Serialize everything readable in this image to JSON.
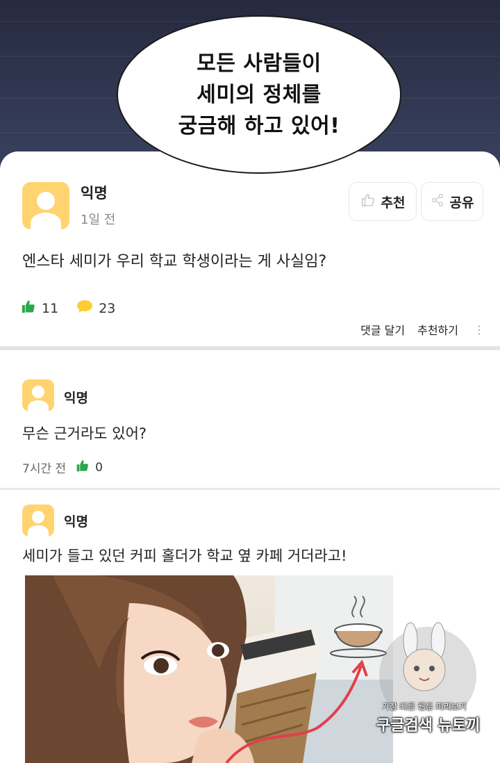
{
  "speech_bubble": {
    "lines": [
      "모든 사람들이",
      "세미의 정체를",
      "궁금해 하고 있어!"
    ]
  },
  "post": {
    "author": "익명",
    "time": "1일 전",
    "recommend_label": "추천",
    "share_label": "공유",
    "body": "엔스타 세미가 우리 학교 학생이라는 게 사실임?",
    "likes": "11",
    "comments": "23",
    "reply_label": "댓글 달기",
    "recommend_action_label": "추천하기",
    "more_label": "⋮"
  },
  "comments": [
    {
      "author": "익명",
      "body": "무슨 근거라도 있어?",
      "time": "7시간 전",
      "likes": "0"
    },
    {
      "author": "익명",
      "body": "세미가 들고 있던 커피 홀더가 학교 옆 카페 거더라고!"
    }
  ],
  "watermark": {
    "line1": "가장 빠른 웹툰 미리보기",
    "line2": "구글검색 뉴토끼"
  },
  "colors": {
    "avatar": "#ffd470",
    "like_green": "#2aa84a",
    "comment_yellow": "#ffcc33",
    "background_dark": "#2e3349"
  }
}
